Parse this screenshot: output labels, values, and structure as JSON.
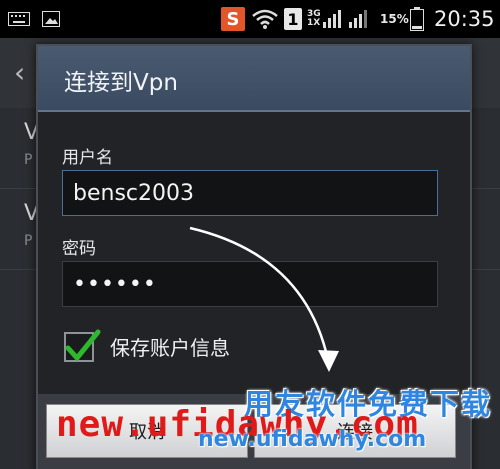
{
  "status_bar": {
    "app_badge": "S",
    "sim_badge": "1",
    "network_label_top": "3G",
    "network_label_bottom": "1X",
    "battery_percent": "15%",
    "time": "20:35",
    "icons": [
      "keyboard-icon",
      "image-icon",
      "wifi-icon",
      "signal-icon",
      "battery-icon"
    ]
  },
  "background_list": {
    "rows": [
      {
        "title": "V",
        "subtitle": "P"
      },
      {
        "title": "V",
        "subtitle": "P"
      }
    ]
  },
  "dialog": {
    "title": "连接到Vpn",
    "username_label": "用户名",
    "username_value": "bensc2003",
    "password_label": "密码",
    "password_value": "••••••",
    "save_label": "保存账户信息",
    "save_checked": true,
    "cancel_label": "取消",
    "connect_label": "连接"
  },
  "watermark": {
    "chinese": "用友软件免费下载",
    "url_red": "new.ufidawhy.com",
    "url_blue": "new.ufidawhy.com"
  },
  "colors": {
    "accent": "#4a6d9a",
    "check": "#2eb82e",
    "watermark_red": "#e01919",
    "watermark_blue": "#2f86e0"
  }
}
